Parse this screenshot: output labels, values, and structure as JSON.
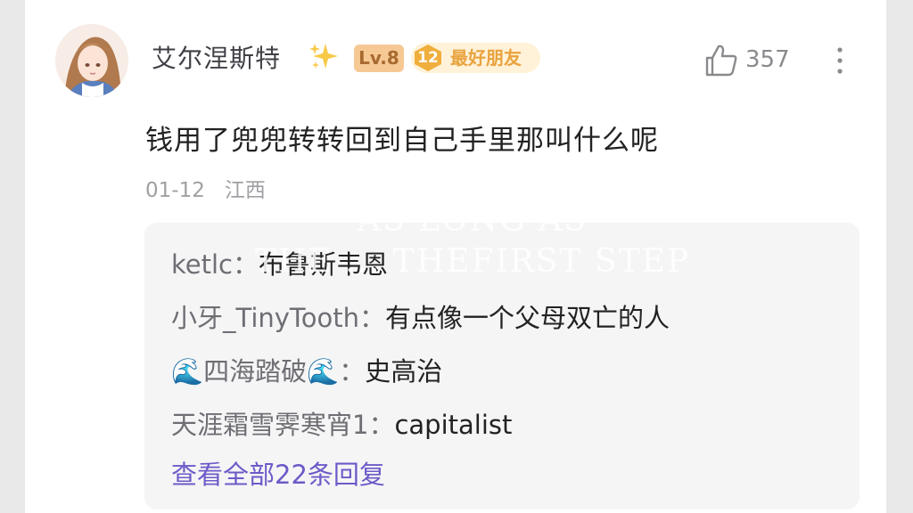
{
  "comment": {
    "username": "艾尔涅斯特",
    "sparkle_emoji": "✨",
    "level_badge": "Lv.8",
    "fan_level": "12",
    "fan_label": "最好朋友",
    "like_count": "357",
    "text": "钱用了兜兜转转回到自己手里那叫什么呢",
    "date": "01-12",
    "location": "江西"
  },
  "watermark": {
    "line1": "AS LONG AS",
    "line2": "THE  ... THEFIRST STEP"
  },
  "replies": {
    "items": [
      {
        "name": "ketlc",
        "separator": "：",
        "text": "布鲁斯韦恩"
      },
      {
        "name": "小牙_TinyTooth",
        "separator": "：",
        "text": "有点像一个父母双亡的人"
      },
      {
        "name": "🌊四海踏破🌊",
        "separator": "：",
        "text": "史高治"
      },
      {
        "name": "天涯霜雪霁寒宵1",
        "separator": "：",
        "text": "capitalist"
      }
    ],
    "view_all": "查看全部22条回复"
  },
  "icons": {
    "like": "thumbs-up-icon",
    "more": "more-vertical-icon",
    "sparkle": "sparkles-emoji",
    "wave": "water-wave-emoji"
  },
  "colors": {
    "accent_link": "#6d5ac8",
    "level_badge_bg": "#f6c994",
    "fan_badge_text": "#e9a33e"
  }
}
